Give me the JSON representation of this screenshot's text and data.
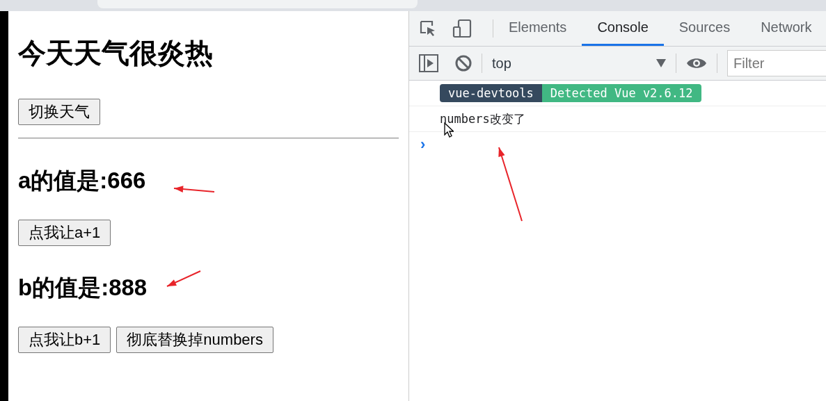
{
  "page": {
    "title": "今天天气很炎热",
    "weather_button": "切换天气",
    "sections": [
      {
        "value_text": "a的值是:666",
        "buttons": [
          "点我让a+1"
        ]
      },
      {
        "value_text": "b的值是:888",
        "buttons": [
          "点我让b+1",
          "彻底替换掉numbers"
        ]
      }
    ]
  },
  "devtools": {
    "tabs": [
      {
        "label": "Elements",
        "selected": false
      },
      {
        "label": "Console",
        "selected": true
      },
      {
        "label": "Sources",
        "selected": false
      },
      {
        "label": "Network",
        "selected": false
      }
    ],
    "context": "top",
    "filter": {
      "placeholder": "Filter"
    },
    "messages": [
      {
        "kind": "badge",
        "parts": [
          "vue-devtools",
          "Detected Vue v2.6.12"
        ]
      },
      {
        "kind": "log",
        "text": "numbers改变了"
      }
    ],
    "prompt": "›"
  }
}
